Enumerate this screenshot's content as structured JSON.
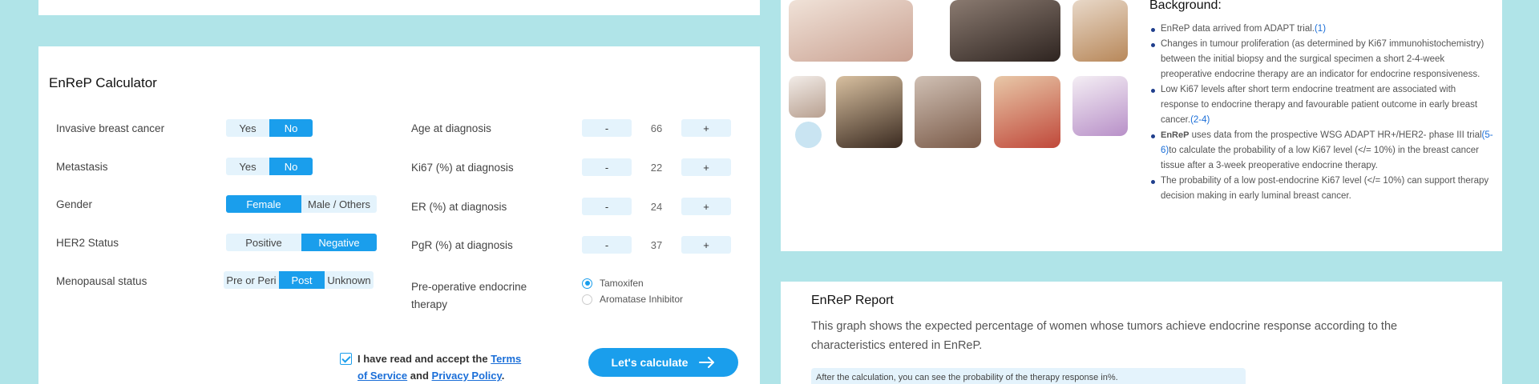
{
  "calculator": {
    "title": "EnReP Calculator",
    "left_rows": [
      {
        "label": "Invasive breast cancer",
        "options": [
          "Yes",
          "No"
        ],
        "selected": "No"
      },
      {
        "label": "Metastasis",
        "options": [
          "Yes",
          "No"
        ],
        "selected": "No"
      },
      {
        "label": "Gender",
        "options": [
          "Female",
          "Male / Others"
        ],
        "selected": "Female"
      },
      {
        "label": "HER2 Status",
        "options": [
          "Positive",
          "Negative"
        ],
        "selected": "Negative"
      },
      {
        "label": "Menopausal status",
        "options": [
          "Pre or Peri",
          "Post",
          "Unknown"
        ],
        "selected": "Post"
      }
    ],
    "right_rows": [
      {
        "label": "Age at diagnosis",
        "minus": "-",
        "value": "66",
        "plus": "+"
      },
      {
        "label": "Ki67 (%) at diagnosis",
        "minus": "-",
        "value": "22",
        "plus": "+"
      },
      {
        "label": "ER (%) at diagnosis",
        "minus": "-",
        "value": "24",
        "plus": "+"
      },
      {
        "label": "PgR (%) at diagnosis",
        "minus": "-",
        "value": "37",
        "plus": "+"
      }
    ],
    "therapy": {
      "label": "Pre-operative endocrine therapy",
      "options": [
        "Tamoxifen",
        "Aromatase Inhibitor"
      ],
      "selected": "Tamoxifen"
    },
    "terms": {
      "checked": true,
      "prefix": "I have read and accept the",
      "link1": "Terms of Service",
      "and": "and",
      "link2": "Privacy Policy",
      "suffix": "."
    },
    "calculate_label": "Let's calculate"
  },
  "background": {
    "title": "Background:",
    "items": [
      {
        "text": "EnReP data arrived from ADAPT trial.",
        "ref": "(1)"
      },
      {
        "text": "Changes in tumour proliferation (as determined by Ki67 immunohistochemistry) between the initial biopsy and the surgical specimen a short 2-4-week preoperative endocrine therapy are an indicator for endocrine responsiveness."
      },
      {
        "text": "Low Ki67 levels after short term endocrine treatment are associated with response to endocrine therapy and favourable patient outcome in early breast cancer.",
        "ref": "(2-4)"
      },
      {
        "brand": "EnReP",
        "text_a": " uses data from the prospective WSG ADAPT HR+/HER2- phase III trial",
        "ref": "(5-6)",
        "text_b": "to calculate the probability of a low Ki67 level (</= 10%) in the breast cancer tissue after a 3-week preoperative endocrine therapy."
      },
      {
        "text": "The probability of a low post-endocrine Ki67 level (</= 10%) can support therapy decision making in early luminal breast cancer."
      }
    ]
  },
  "report": {
    "title": "EnReP Report",
    "description": "This graph shows the expected percentage of women whose tumors achieve endocrine response according to the characteristics entered in EnReP.",
    "note": "After the calculation, you can see the probability of the therapy response in%."
  },
  "photos": [
    {
      "name": "woman-photo-1",
      "color": "#d8b8a8"
    },
    {
      "name": "woman-photo-2",
      "color": "#5a4a42"
    },
    {
      "name": "woman-photo-3",
      "color": "#c9a07a"
    },
    {
      "name": "woman-photo-4",
      "color": "#d6c4b8"
    },
    {
      "name": "woman-photo-5",
      "color": "#4e3a2e"
    },
    {
      "name": "woman-photo-6",
      "color": "#9c7a64"
    },
    {
      "name": "woman-photo-7",
      "color": "#c77a4a"
    },
    {
      "name": "woman-photo-8",
      "color": "#c9a8d8"
    }
  ],
  "colors": {
    "page_background": "#b0e4e8",
    "accent": "#1a9eec",
    "link": "#1a6ed8",
    "segment_background": "#e4f3fc"
  }
}
